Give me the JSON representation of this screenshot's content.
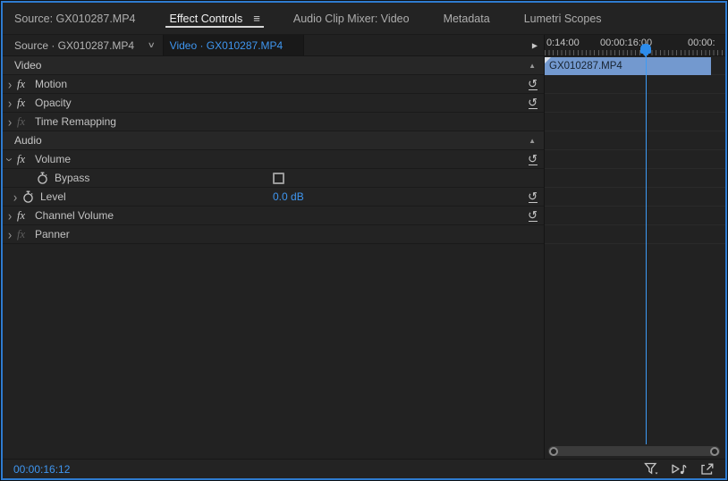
{
  "tab_bar": {
    "tabs": [
      {
        "label": "Source: GX010287.MP4",
        "active": false
      },
      {
        "label": "Effect Controls",
        "active": true
      },
      {
        "label": "Audio Clip Mixer: Video",
        "active": false
      },
      {
        "label": "Metadata",
        "active": false
      },
      {
        "label": "Lumetri Scopes",
        "active": false
      }
    ],
    "menu_icon": "≡"
  },
  "clip_tabs": {
    "source_label": "Source · GX010287.MP4",
    "active_clip_label": "Video · GX010287.MP4"
  },
  "icons": {
    "chevron_down": "∨",
    "chevron_right": "›",
    "collapse_up": "▲",
    "expand_arrow": "▶",
    "reset_glyph": "↺"
  },
  "ruler": {
    "labels": [
      "0:14:00",
      "00:00:16:00",
      "00:00:"
    ]
  },
  "timeline": {
    "clip_name": "GX010287.MP4",
    "playhead_color": "#2d8ceb",
    "clip_color": "#7399cf"
  },
  "effects": {
    "fx_label": "fx",
    "video_section": {
      "label": "Video"
    },
    "audio_section": {
      "label": "Audio"
    },
    "motion": {
      "label": "Motion"
    },
    "opacity": {
      "label": "Opacity"
    },
    "time_remapping": {
      "label": "Time Remapping"
    },
    "volume": {
      "label": "Volume"
    },
    "bypass": {
      "label": "Bypass",
      "checked": false
    },
    "level": {
      "label": "Level",
      "value": "0.0 dB"
    },
    "channel_volume": {
      "label": "Channel Volume"
    },
    "panner": {
      "label": "Panner"
    }
  },
  "status_bar": {
    "timecode": "00:00:16:12"
  },
  "colors": {
    "accent_blue": "#3f96f0",
    "focus_border": "#2e7bd0"
  }
}
